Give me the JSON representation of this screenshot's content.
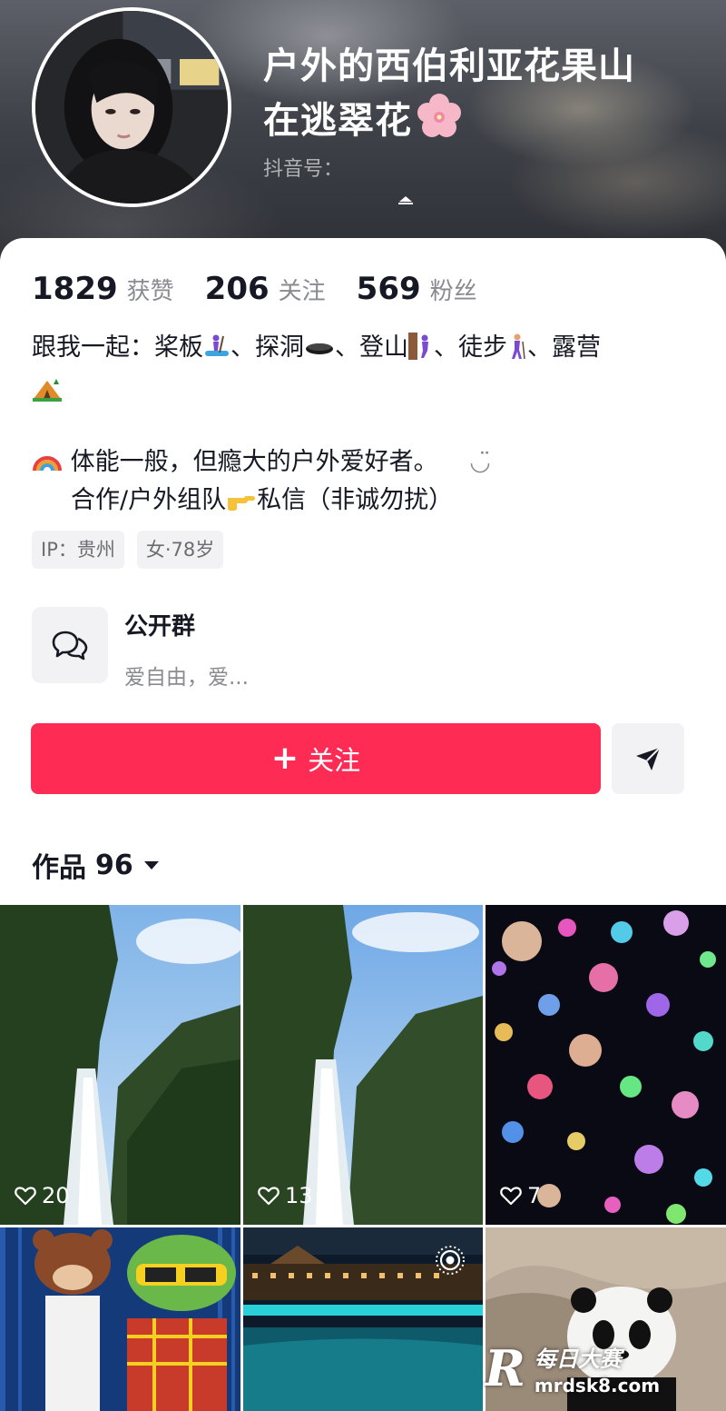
{
  "profile": {
    "nickname_line1": "户外的西伯利亚花果山",
    "nickname_line2": "在逃翠花",
    "douyin_id_label": "抖音号：",
    "nickname_emoji": "blossom-icon"
  },
  "stats": {
    "likes_count": "1829",
    "likes_label": "获赞",
    "following_count": "206",
    "following_label": "关注",
    "followers_count": "569",
    "followers_label": "粉丝"
  },
  "bio": {
    "line1_prefix": "跟我一起：桨板",
    "sep1": "、探洞",
    "sep2": "、登山",
    "sep3": "、徒步",
    "sep4": "、露营",
    "line2": "体能一般，但瘾大的户外爱好者。",
    "line2_suffix": "◡̈",
    "line3_a": "合作/户外组队",
    "line3_b": "私信（非诚勿扰）"
  },
  "tags": {
    "ip": "IP：贵州",
    "gender_age": "女·78岁"
  },
  "group": {
    "title": "公开群",
    "desc": "爱自由，爱..."
  },
  "actions": {
    "follow_plus": "+",
    "follow_label": "关注"
  },
  "works": {
    "label": "作品",
    "count": "96"
  },
  "grid": {
    "tiles": [
      {
        "likes": "20"
      },
      {
        "likes": "13"
      },
      {
        "likes": "7"
      }
    ]
  },
  "watermark": {
    "logo": "R",
    "name": "每日大赛",
    "url": "mrdsk8.com"
  },
  "colors": {
    "accent": "#fe2c55",
    "text": "#161823",
    "muted": "#8a8b91",
    "chip_bg": "#f2f2f4"
  }
}
